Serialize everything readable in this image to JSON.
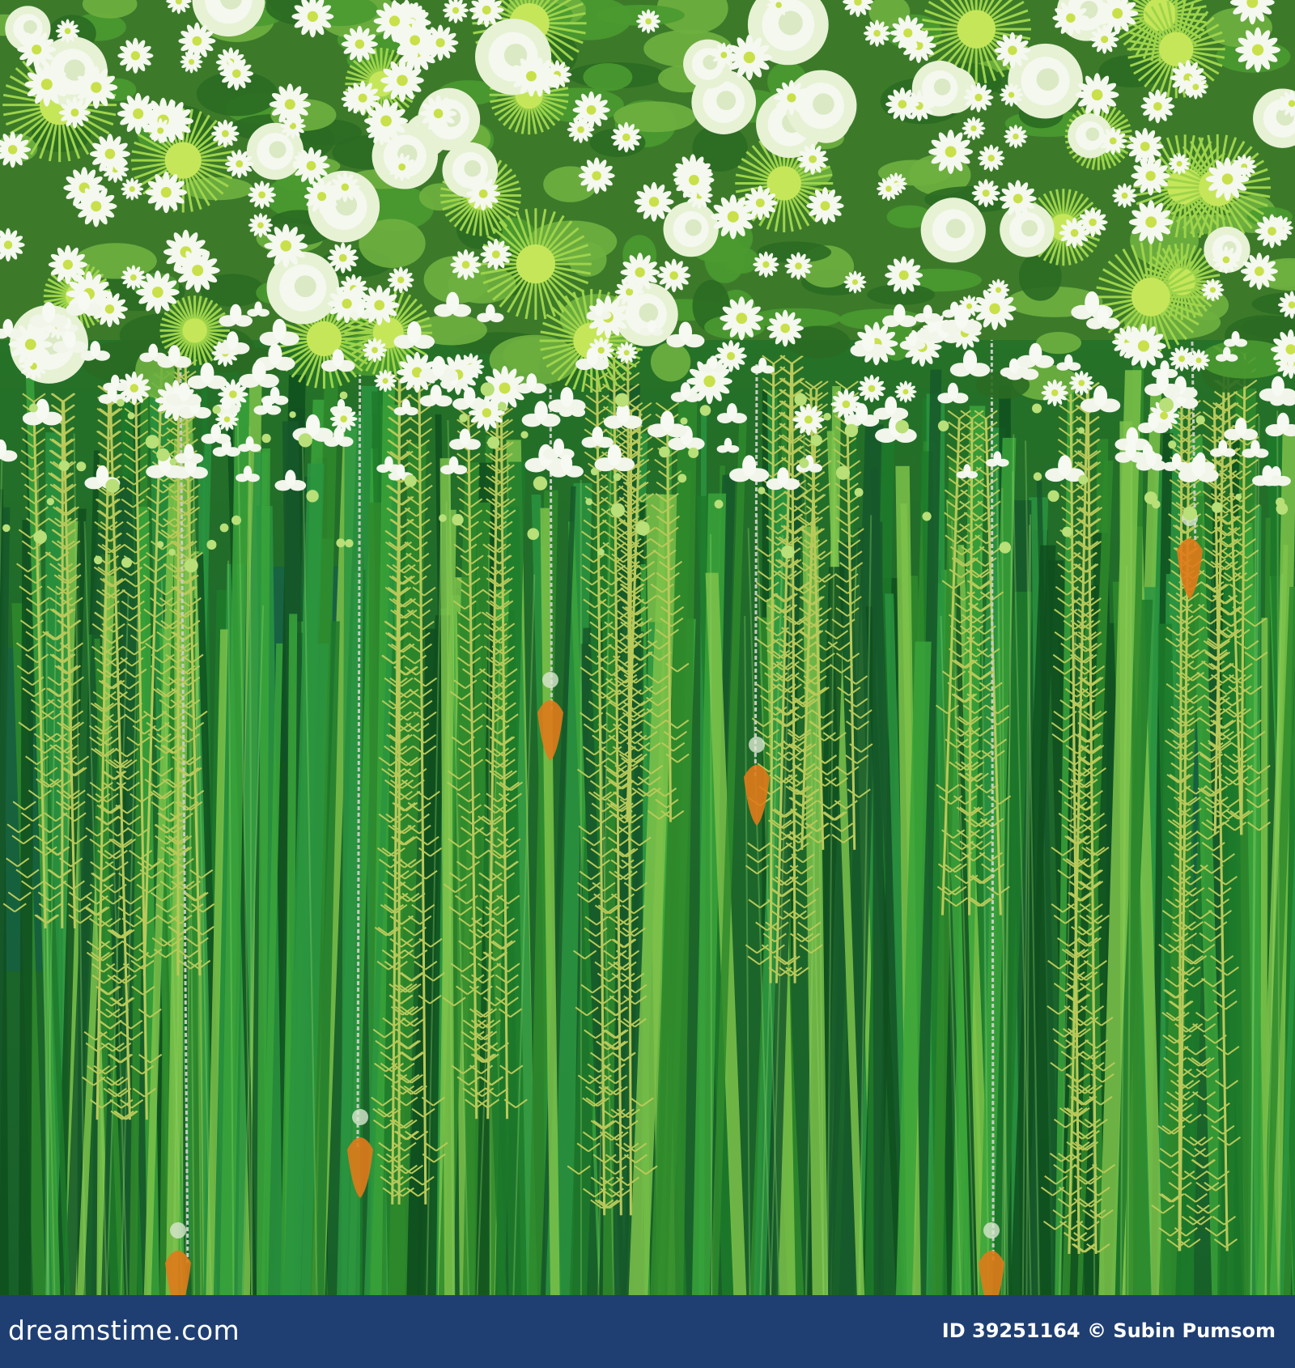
{
  "image": {
    "subject": "green-floral-backdrop-photo",
    "palette": {
      "leaf_dark": "#0f4f1e",
      "leaf_mid": "#2f8a2c",
      "leaf_light": "#7cc24a",
      "fern": "#b9c95a",
      "flower_white": "#f4f8ee",
      "flower_center": "#c9e04a",
      "crystal_orange": "#e07a1a",
      "chain_silver": "#c9ccc4",
      "teal_cloth": "#0f5a5a"
    }
  },
  "footer": {
    "background": "#1f3f73",
    "brand": "dreamstime.com",
    "id_label": "ID 39251164",
    "copyright": "© Subin Pumsom"
  }
}
